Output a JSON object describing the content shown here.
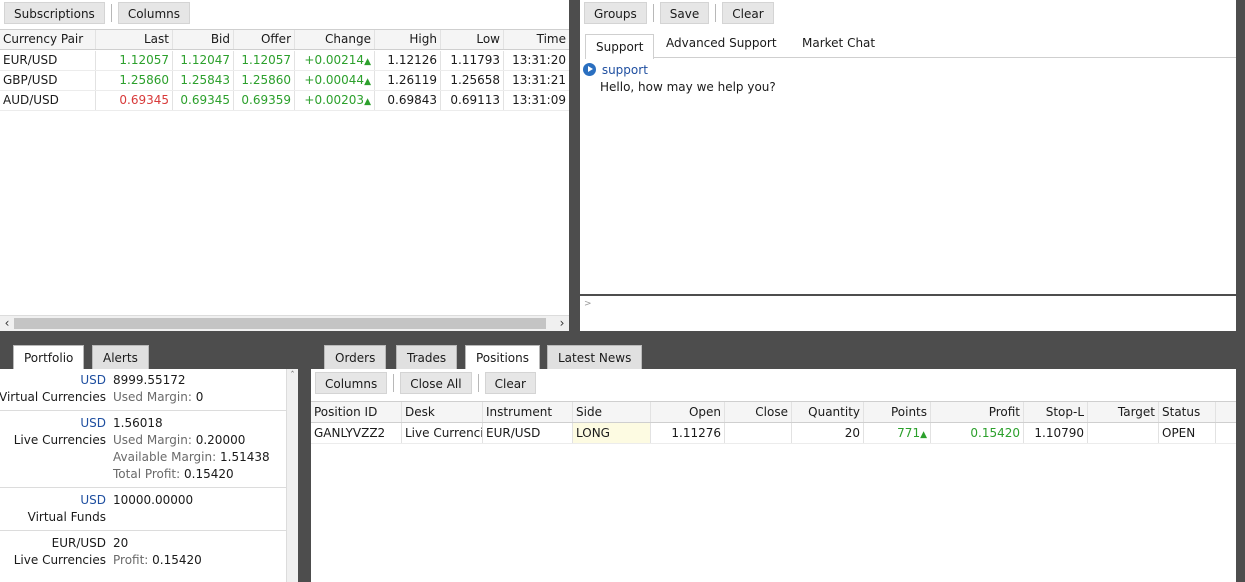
{
  "quotes": {
    "toolbar": {
      "subscriptions": "Subscriptions",
      "columns": "Columns"
    },
    "headers": [
      "Currency Pair",
      "Last",
      "Bid",
      "Offer",
      "Change",
      "High",
      "Low",
      "Time"
    ],
    "rows": [
      {
        "pair": "EUR/USD",
        "last": "1.12057",
        "bid": "1.12047",
        "offer": "1.12057",
        "change": "+0.00214",
        "high": "1.12126",
        "low": "1.11793",
        "time": "13:31:20"
      },
      {
        "pair": "GBP/USD",
        "last": "1.25860",
        "bid": "1.25843",
        "offer": "1.25860",
        "change": "+0.00044",
        "high": "1.26119",
        "low": "1.25658",
        "time": "13:31:21"
      },
      {
        "pair": "AUD/USD",
        "last": "0.69345",
        "bid": "0.69345",
        "offer": "0.69359",
        "change": "+0.00203",
        "high": "0.69843",
        "low": "0.69113",
        "time": "13:31:09"
      }
    ],
    "up_arrow": "▲"
  },
  "chat": {
    "toolbar": {
      "groups": "Groups",
      "save": "Save",
      "clear": "Clear"
    },
    "tabs": [
      "Support",
      "Advanced Support",
      "Market Chat"
    ],
    "message": {
      "sender": "support",
      "text": "Hello, how may we help you?"
    },
    "input_prompt": ">"
  },
  "portfolio": {
    "tabs": [
      "Portfolio",
      "Alerts"
    ],
    "entries": [
      {
        "currency": "USD",
        "amount": "8999.55172",
        "type": "Virtual Currencies",
        "details": [
          [
            "Used Margin:",
            "0"
          ]
        ]
      },
      {
        "currency": "USD",
        "amount": "1.56018",
        "type": "Live Currencies",
        "details": [
          [
            "Used Margin:",
            "0.20000"
          ],
          [
            "Available Margin:",
            "1.51438"
          ],
          [
            "Total Profit:",
            "0.15420"
          ]
        ]
      },
      {
        "currency": "USD",
        "amount": "10000.00000",
        "type": "Virtual Funds",
        "details": []
      },
      {
        "currency": "EUR/USD",
        "amount": "20",
        "type": "Live Currencies",
        "details": [
          [
            "Profit:",
            "0.15420"
          ]
        ]
      }
    ]
  },
  "trading": {
    "tabs": [
      "Orders",
      "Trades",
      "Positions",
      "Latest News"
    ],
    "toolbar": {
      "columns": "Columns",
      "close_all": "Close All",
      "clear": "Clear"
    },
    "headers": [
      "Position ID",
      "Desk",
      "Instrument",
      "Side",
      "Open",
      "Close",
      "Quantity",
      "Points",
      "Profit",
      "Stop-L",
      "Target",
      "Status"
    ],
    "row": {
      "position_id": "GANLYVZZ2",
      "desk": "Live Currencies",
      "instrument": "EUR/USD",
      "side": "LONG",
      "open": "1.11276",
      "close": "",
      "quantity": "20",
      "points": "771",
      "profit": "0.15420",
      "stop_loss": "1.10790",
      "target": "",
      "status": "OPEN"
    }
  },
  "colors": {
    "up": "#2ca02c",
    "down": "#d83a3a",
    "link": "#1f4fa0",
    "side_highlight": "#fdfbe2"
  }
}
